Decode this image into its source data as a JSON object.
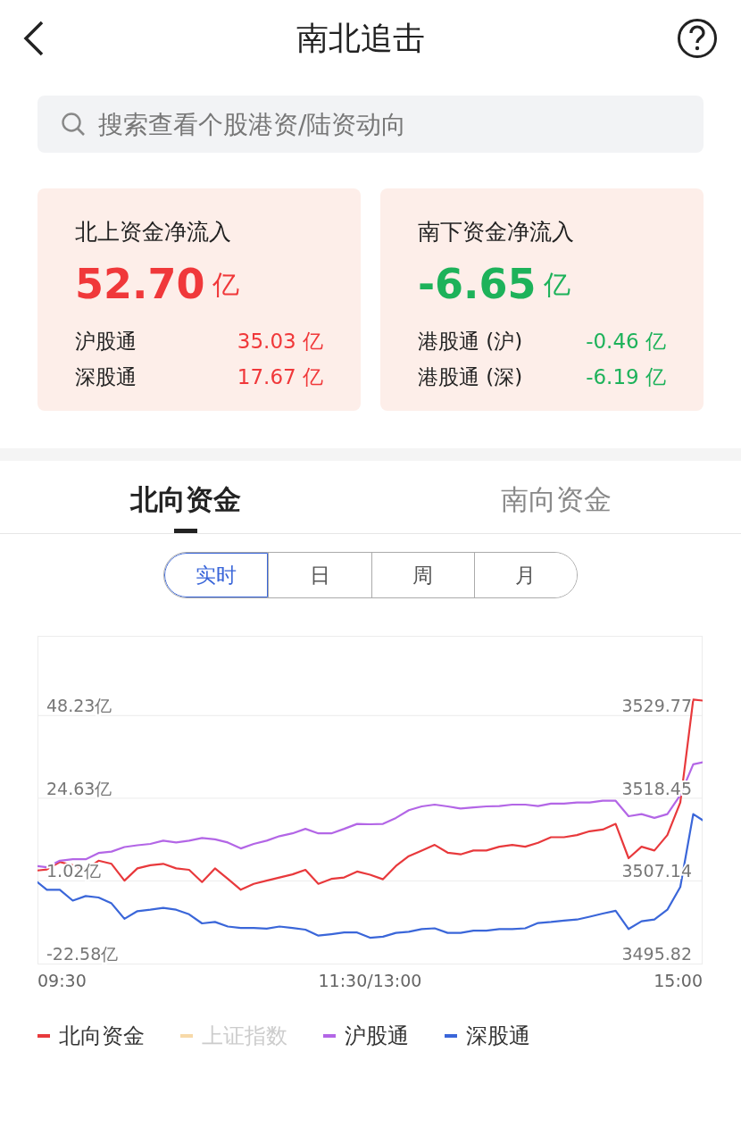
{
  "header": {
    "title": "南北追击"
  },
  "search": {
    "placeholder": "搜索查看个股港资/陆资动向"
  },
  "summary_cards": [
    {
      "title": "北上资金净流入",
      "amount": "52.70",
      "unit": "亿",
      "color": "#f0383a",
      "rows": [
        {
          "label": "沪股通",
          "value": "35.03 亿",
          "color": "#f0383a"
        },
        {
          "label": "深股通",
          "value": "17.67 亿",
          "color": "#f0383a"
        }
      ]
    },
    {
      "title": "南下资金净流入",
      "amount": "-6.65",
      "unit": "亿",
      "color": "#1db25a",
      "rows": [
        {
          "label": "港股通 (沪)",
          "value": "-0.46 亿",
          "color": "#1db25a"
        },
        {
          "label": "港股通 (深)",
          "value": "-6.19 亿",
          "color": "#1db25a"
        }
      ]
    }
  ],
  "tabs": [
    {
      "label": "北向资金",
      "selected": true
    },
    {
      "label": "南向资金",
      "selected": false
    }
  ],
  "periods": [
    {
      "label": "实时",
      "selected": true
    },
    {
      "label": "日",
      "selected": false
    },
    {
      "label": "周",
      "selected": false
    },
    {
      "label": "月",
      "selected": false
    }
  ],
  "chart": {
    "right_axis_labels": [
      "3529.77",
      "3518.45",
      "3507.14",
      "3495.82"
    ],
    "chart_data": {
      "type": "line",
      "grid": true,
      "categories": [
        null,
        null,
        "09:30",
        null,
        null,
        null,
        null,
        null,
        null,
        null,
        null,
        null,
        null,
        null,
        null,
        null,
        null,
        null,
        null,
        null,
        null,
        null,
        null,
        null,
        null,
        null,
        "11:30/13:00",
        null,
        null,
        null,
        null,
        null,
        null,
        null,
        null,
        null,
        null,
        null,
        null,
        null,
        null,
        null,
        null,
        null,
        null,
        null,
        null,
        null,
        null,
        null,
        "15:00",
        null,
        null
      ],
      "ylim": [
        -22.58,
        71
      ],
      "yticks": [
        {
          "value": 48.23,
          "label": "48.23亿"
        },
        {
          "value": 24.63,
          "label": "24.63亿"
        },
        {
          "value": 1.02,
          "label": "1.02亿"
        },
        {
          "value": -22.58,
          "label": "-22.58亿"
        }
      ],
      "series": [
        {
          "name": "北向资金",
          "color": "#e8393c",
          "values": [
            3.9,
            4.3,
            6.4,
            5.5,
            4.2,
            6.8,
            5.9,
            1.1,
            4.6,
            5.5,
            5.9,
            4.6,
            4.2,
            0.7,
            4.6,
            1.6,
            -1.5,
            0.2,
            1.1,
            2.0,
            2.9,
            4.2,
            0.2,
            1.6,
            2.0,
            3.7,
            2.8,
            1.5,
            5.3,
            8.1,
            9.7,
            11.3,
            9.1,
            8.6,
            9.7,
            9.7,
            10.8,
            11.3,
            10.8,
            11.9,
            13.5,
            13.5,
            14.1,
            15.2,
            15.7,
            17.3,
            7.5,
            10.8,
            9.7,
            14.1,
            23.4,
            52.8,
            52.4
          ]
        },
        {
          "name": "上证指数",
          "color": "#f7d9a8",
          "values": [
            null,
            null,
            null,
            null,
            null,
            null,
            null,
            null,
            null,
            null,
            null,
            null,
            null,
            null,
            null,
            null,
            null,
            null,
            null,
            null,
            null,
            null,
            null,
            null,
            null,
            null,
            null,
            null,
            null,
            null,
            null,
            null,
            null,
            null,
            null,
            null,
            null,
            null,
            null,
            null,
            null,
            null,
            null,
            null,
            null,
            null,
            null,
            null,
            null,
            null,
            null,
            null,
            null
          ]
        },
        {
          "name": "沪股通",
          "color": "#b366e6",
          "values": [
            5.4,
            4.9,
            6.8,
            7.2,
            7.2,
            9.0,
            9.4,
            10.7,
            11.2,
            11.6,
            12.5,
            12.0,
            12.5,
            13.3,
            12.9,
            12.0,
            10.3,
            11.6,
            12.5,
            13.8,
            14.6,
            15.9,
            14.6,
            14.6,
            15.9,
            17.3,
            17.2,
            17.3,
            19.0,
            21.2,
            22.3,
            22.8,
            22.3,
            21.7,
            22.0,
            22.3,
            22.4,
            22.8,
            22.8,
            22.4,
            23.1,
            23.1,
            23.4,
            23.4,
            23.9,
            23.9,
            19.5,
            20.1,
            19.0,
            20.1,
            25.5,
            34.3,
            35.1
          ]
        },
        {
          "name": "深股通",
          "color": "#3a66d9",
          "values": [
            1.5,
            -1.5,
            -1.5,
            -4.6,
            -3.3,
            -3.7,
            -5.4,
            -9.8,
            -7.6,
            -7.2,
            -6.7,
            -7.2,
            -8.5,
            -11.1,
            -10.7,
            -12.0,
            -12.4,
            -12.4,
            -12.6,
            -12.0,
            -12.4,
            -12.9,
            -14.6,
            -14.2,
            -13.7,
            -13.7,
            -15.2,
            -14.9,
            -13.8,
            -13.5,
            -12.7,
            -12.5,
            -13.8,
            -13.8,
            -13.2,
            -13.2,
            -12.7,
            -12.7,
            -12.5,
            -11.0,
            -10.7,
            -10.3,
            -10.0,
            -9.2,
            -8.3,
            -7.5,
            -12.7,
            -10.5,
            -10.0,
            -7.2,
            -0.7,
            20.1,
            17.7
          ]
        }
      ]
    }
  }
}
